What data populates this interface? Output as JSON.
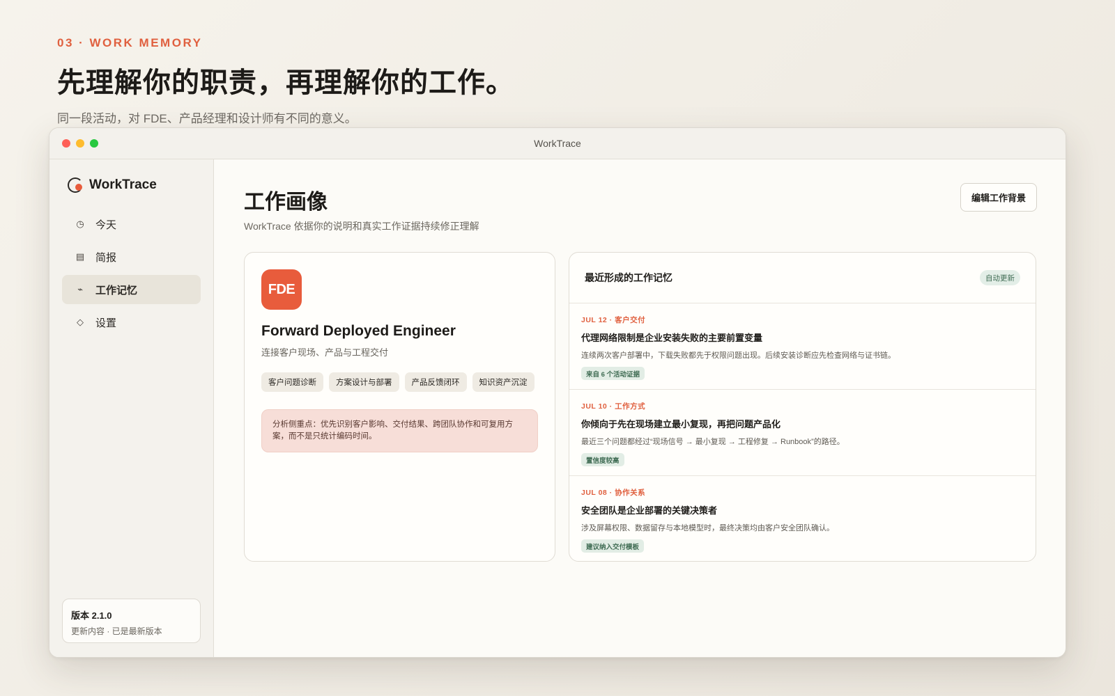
{
  "hero": {
    "eyebrow": "03 · WORK MEMORY",
    "headline": "先理解你的职责，再理解你的工作。",
    "subhead": "同一段活动，对 FDE、产品经理和设计师有不同的意义。"
  },
  "window": {
    "title": "WorkTrace"
  },
  "sidebar": {
    "brand": "WorkTrace",
    "items": [
      {
        "label": "今天",
        "icon": "clock-icon",
        "glyph": "◷"
      },
      {
        "label": "简报",
        "icon": "report-icon",
        "glyph": "▤"
      },
      {
        "label": "工作记忆",
        "icon": "memory-icon",
        "glyph": "⌁"
      },
      {
        "label": "设置",
        "icon": "settings-icon",
        "glyph": "◇"
      }
    ],
    "active_index": 2,
    "version": {
      "title": "版本 2.1.0",
      "sub": "更新内容 · 已是最新版本"
    }
  },
  "main": {
    "title": "工作画像",
    "subtitle": "WorkTrace 依据你的说明和真实工作证据持续修正理解",
    "edit_button": "编辑工作背景"
  },
  "profile": {
    "badge": "FDE",
    "role": "Forward Deployed Engineer",
    "role_sub": "连接客户现场、产品与工程交付",
    "tags": [
      "客户问题诊断",
      "方案设计与部署",
      "产品反馈闭环",
      "知识资产沉淀"
    ],
    "focus": "分析侧重点：优先识别客户影响、交付结果、跨团队协作和可复用方案，而不是只统计编码时间。"
  },
  "memory": {
    "title": "最近形成的工作记忆",
    "badge": "自动更新",
    "items": [
      {
        "meta": "JUL 12 · 客户交付",
        "title": "代理网络限制是企业安装失败的主要前置变量",
        "desc": "连续两次客户部署中，下载失败都先于权限问题出现。后续安装诊断应先检查网络与证书链。",
        "tag": "来自 6 个活动证据"
      },
      {
        "meta": "JUL 10 · 工作方式",
        "title": "你倾向于先在现场建立最小复现，再把问题产品化",
        "desc": "最近三个问题都经过“现场信号 → 最小复现 → 工程修复 → Runbook”的路径。",
        "tag": "置信度较高"
      },
      {
        "meta": "JUL 08 · 协作关系",
        "title": "安全团队是企业部署的关键决策者",
        "desc": "涉及屏幕权限、数据留存与本地模型时，最终决策均由客户安全团队确认。",
        "tag": "建议纳入交付模板"
      }
    ]
  },
  "colors": {
    "accent": "#e85c3c",
    "success_bg": "#e2ede5",
    "success_text": "#3e6b52"
  }
}
